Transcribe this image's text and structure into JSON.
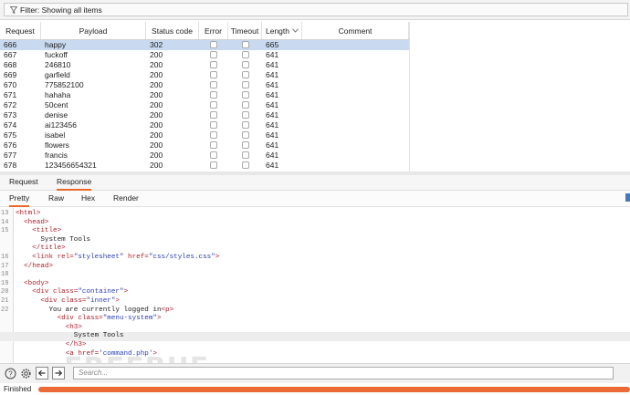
{
  "filter": {
    "text": "Filter: Showing all items"
  },
  "table": {
    "columns": [
      "Request",
      "Payload",
      "Status code",
      "Error",
      "Timeout",
      "Length",
      "Comment"
    ],
    "rows": [
      {
        "request": "666",
        "payload": "happy",
        "status": "302",
        "length": "665",
        "selected": true
      },
      {
        "request": "667",
        "payload": "fuckoff",
        "status": "200",
        "length": "641"
      },
      {
        "request": "668",
        "payload": "246810",
        "status": "200",
        "length": "641"
      },
      {
        "request": "669",
        "payload": "garfield",
        "status": "200",
        "length": "641"
      },
      {
        "request": "670",
        "payload": "775852100",
        "status": "200",
        "length": "641"
      },
      {
        "request": "671",
        "payload": "hahaha",
        "status": "200",
        "length": "641"
      },
      {
        "request": "672",
        "payload": "50cent",
        "status": "200",
        "length": "641"
      },
      {
        "request": "673",
        "payload": "denise",
        "status": "200",
        "length": "641"
      },
      {
        "request": "674",
        "payload": "ai123456",
        "status": "200",
        "length": "641"
      },
      {
        "request": "675",
        "payload": "isabel",
        "status": "200",
        "length": "641"
      },
      {
        "request": "676",
        "payload": "flowers",
        "status": "200",
        "length": "641"
      },
      {
        "request": "677",
        "payload": "francis",
        "status": "200",
        "length": "641"
      },
      {
        "request": "678",
        "payload": "123456654321",
        "status": "200",
        "length": "641"
      }
    ]
  },
  "tabs": {
    "request": "Request",
    "response": "Response"
  },
  "subtabs": {
    "pretty": "Pretty",
    "raw": "Raw",
    "hex": "Hex",
    "render": "Render"
  },
  "code_lines": [
    {
      "n": "13",
      "parts": [
        [
          "tg",
          "<html>"
        ]
      ]
    },
    {
      "n": "14",
      "parts": [
        [
          "t",
          "  "
        ],
        [
          "tg",
          "<head>"
        ]
      ]
    },
    {
      "n": "15",
      "parts": [
        [
          "t",
          "    "
        ],
        [
          "tg",
          "<title>"
        ]
      ]
    },
    {
      "n": "",
      "parts": [
        [
          "t",
          "      System Tools"
        ]
      ]
    },
    {
      "n": "",
      "parts": [
        [
          "t",
          "    "
        ],
        [
          "tg",
          "</title>"
        ]
      ]
    },
    {
      "n": "16",
      "parts": [
        [
          "t",
          "    "
        ],
        [
          "tg",
          "<link "
        ],
        [
          "at",
          "rel="
        ],
        [
          "vl",
          "\"stylesheet\""
        ],
        [
          "at",
          " href="
        ],
        [
          "vl",
          "\"css/styles.css\""
        ],
        [
          "tg",
          ">"
        ]
      ]
    },
    {
      "n": "17",
      "parts": [
        [
          "t",
          "  "
        ],
        [
          "tg",
          "</head>"
        ]
      ]
    },
    {
      "n": "18",
      "parts": []
    },
    {
      "n": "19",
      "parts": [
        [
          "t",
          "  "
        ],
        [
          "tg",
          "<body>"
        ]
      ]
    },
    {
      "n": "20",
      "parts": [
        [
          "t",
          "    "
        ],
        [
          "tg",
          "<div "
        ],
        [
          "at",
          "class="
        ],
        [
          "vl",
          "\"container\""
        ],
        [
          "tg",
          ">"
        ]
      ]
    },
    {
      "n": "21",
      "parts": [
        [
          "t",
          "      "
        ],
        [
          "tg",
          "<div "
        ],
        [
          "at",
          "class="
        ],
        [
          "vl",
          "\"inner\""
        ],
        [
          "tg",
          ">"
        ]
      ]
    },
    {
      "n": "22",
      "parts": [
        [
          "t",
          "        You are currently logged in"
        ],
        [
          "tg",
          "<p>"
        ]
      ]
    },
    {
      "n": "",
      "parts": [
        [
          "t",
          "          "
        ],
        [
          "tg",
          "<div "
        ],
        [
          "at",
          "class="
        ],
        [
          "vl",
          "\"menu-system\""
        ],
        [
          "tg",
          ">"
        ]
      ]
    },
    {
      "n": "",
      "parts": [
        [
          "t",
          "            "
        ],
        [
          "tg",
          "<h3>"
        ]
      ]
    },
    {
      "n": "",
      "parts": [
        [
          "t",
          "              System Tools"
        ]
      ],
      "hl": true
    },
    {
      "n": "",
      "parts": [
        [
          "t",
          "            "
        ],
        [
          "tg",
          "</h3>"
        ]
      ]
    },
    {
      "n": "",
      "parts": [
        [
          "t",
          "            "
        ],
        [
          "tg",
          "<a "
        ],
        [
          "at",
          "href="
        ],
        [
          "vl",
          "'command.php'"
        ],
        [
          "tg",
          ">"
        ]
      ]
    }
  ],
  "search": {
    "placeholder": "Search..."
  },
  "status": {
    "label": "Finished",
    "progress": 1.0
  },
  "watermark": "FREEBUF"
}
